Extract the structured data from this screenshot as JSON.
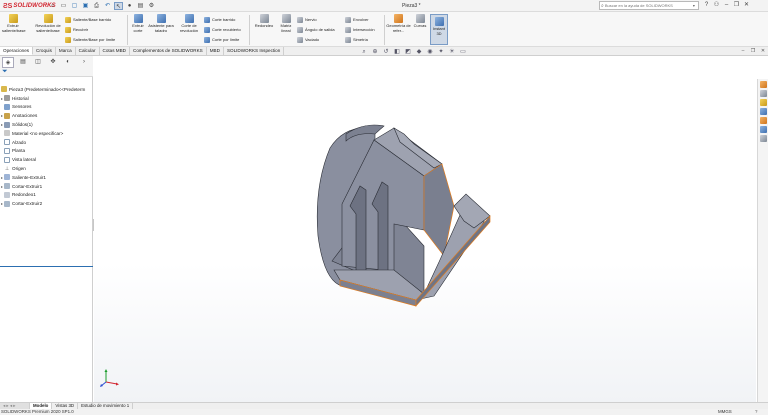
{
  "app": {
    "logo_text": "SOLIDWORKS",
    "document_title": "Pieza3 *",
    "search": {
      "placeholder": "Buscar en la ayuda de SOLIDWORKS"
    }
  },
  "quick_access": [
    "home-icon",
    "new-icon",
    "open-icon",
    "save-icon",
    "print-icon",
    "undo-icon",
    "select-icon",
    "rebuild-icon",
    "file-properties-icon",
    "options-icon"
  ],
  "ribbon": {
    "extrude_boss": "Extruir saliente/base",
    "revolve_boss": "Revolución de saliente/base",
    "swept_boss": "Saliente/Base barrido",
    "lofted_boss": "Recubrir",
    "boundary_boss": "Saliente/Base por límite",
    "extrude_cut": "Extruir corte",
    "hole_wizard": "Asistente para taladro",
    "revolve_cut": "Corte de revolución",
    "swept_cut": "Corte barrido",
    "lofted_cut": "Corte recubierto",
    "boundary_cut": "Corte por límite",
    "fillet": "Redondeo",
    "linear_pattern": "Matriz lineal",
    "rib": "Nervio",
    "draft": "Ángulo de salida",
    "shell": "Vaciado",
    "wrap": "Envolver",
    "intersect": "Intersección",
    "mirror": "Simetría",
    "reference_geometry": "Geometría de refer...",
    "curves": "Curvas",
    "instant3d": "Instant 3D"
  },
  "tabs": [
    "Operaciones",
    "Croquis",
    "Marca",
    "Calcular",
    "Cotas MBD",
    "Complementos de SOLIDWORKS",
    "MBD",
    "SOLIDWORKS Inspection"
  ],
  "tree": {
    "root": "Pieza3  (Predeterminado<<Predeterm",
    "items": [
      {
        "label": "Historial",
        "icon": "history-icon",
        "expand": true
      },
      {
        "label": "Sensores",
        "icon": "sensor-icon",
        "expand": false
      },
      {
        "label": "Anotaciones",
        "icon": "annotations-icon",
        "expand": true
      },
      {
        "label": "Sólidos(1)",
        "icon": "solid-bodies-icon",
        "expand": true
      },
      {
        "label": "Material <no especificar>",
        "icon": "material-icon",
        "expand": false
      },
      {
        "label": "Alzado",
        "icon": "plane-icon",
        "expand": false
      },
      {
        "label": "Planta",
        "icon": "plane-icon",
        "expand": false
      },
      {
        "label": "Vista lateral",
        "icon": "plane-icon",
        "expand": false
      },
      {
        "label": "Origen",
        "icon": "origin-icon",
        "expand": false
      },
      {
        "label": "Saliente-Extruir1",
        "icon": "boss-extrude-icon",
        "expand": true
      },
      {
        "label": "Cortar-Extruir1",
        "icon": "cut-extrude-icon",
        "expand": true
      },
      {
        "label": "Redondeo1",
        "icon": "fillet-icon",
        "expand": false
      },
      {
        "label": "Cortar-Extruir2",
        "icon": "cut-extrude-icon",
        "expand": true
      }
    ]
  },
  "bottom_tabs": [
    "Modelo",
    "Vistas 3D",
    "Estudio de movimiento 1"
  ],
  "status": {
    "left": "SOLIDWORKS Premium 2020 SP1.0",
    "units": "MMGS",
    "help": "?"
  },
  "colors": {
    "brand": "#d22630",
    "model_face": "#8a8f9f",
    "model_edge": "#e07b1e",
    "accent": "#2c6fb1"
  }
}
